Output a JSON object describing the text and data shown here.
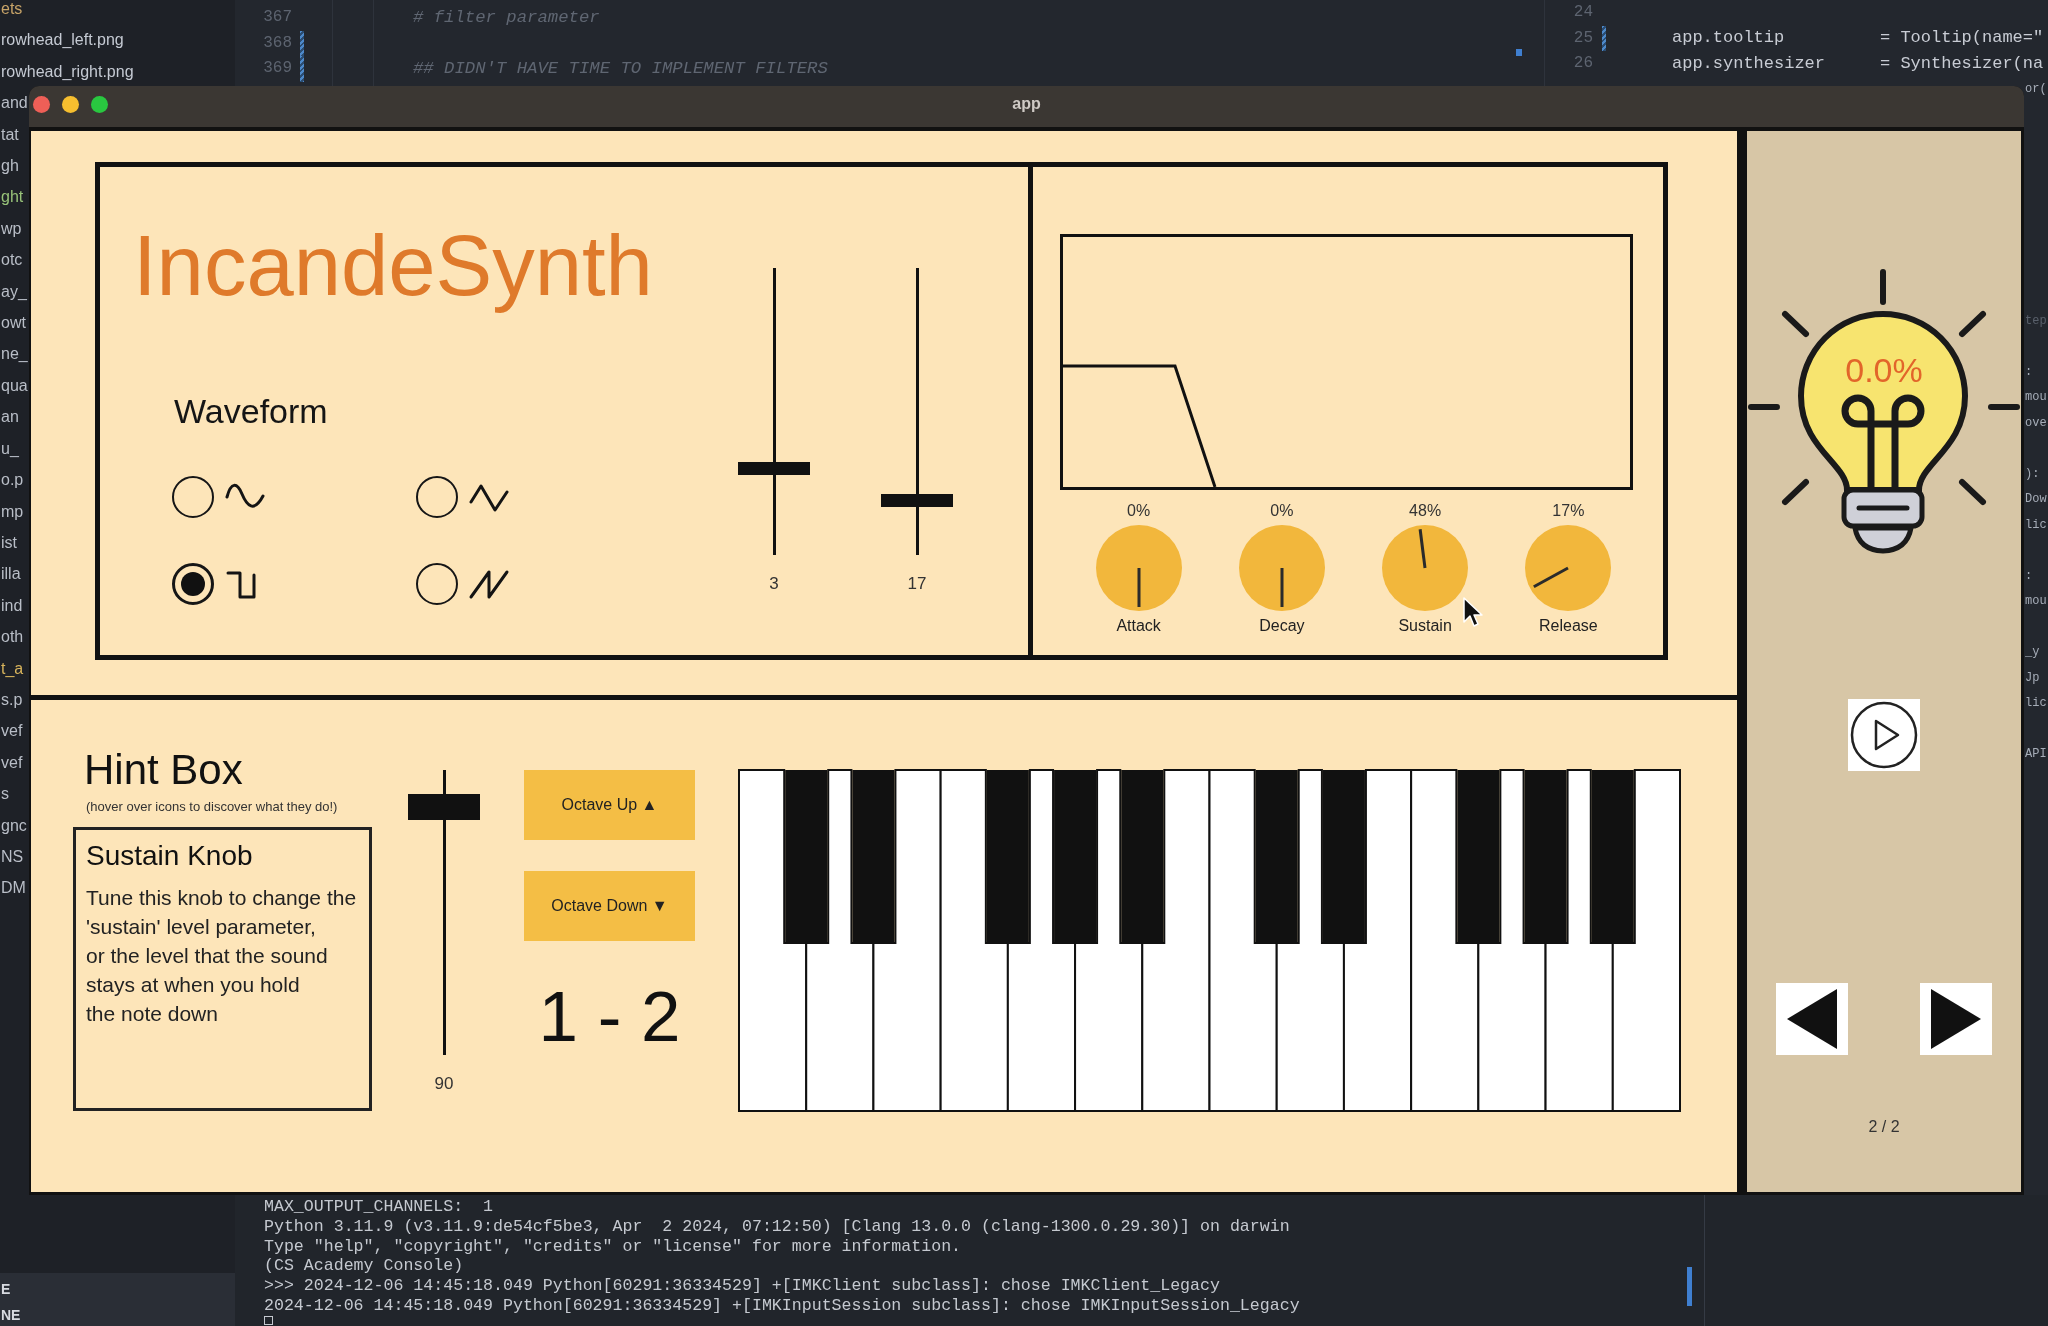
{
  "file_explorer": {
    "items": [
      {
        "label": "ets",
        "color": "#c8a468"
      },
      {
        "label": "rowhead_left.png",
        "color": "#c5cad3"
      },
      {
        "label": "rowhead_right.png",
        "color": "#c5cad3"
      },
      {
        "label": "and",
        "color": "#b9bec7"
      },
      {
        "label": "tat",
        "color": "#b9bec7"
      },
      {
        "label": "gh",
        "color": "#b9bec7"
      },
      {
        "label": "ght",
        "color": "#98c379"
      },
      {
        "label": "wp",
        "color": "#b9bec7"
      },
      {
        "label": "otc",
        "color": "#b9bec7"
      },
      {
        "label": "ay_",
        "color": "#b9bec7"
      },
      {
        "label": "owt",
        "color": "#b9bec7"
      },
      {
        "label": "ne_",
        "color": "#b9bec7"
      },
      {
        "label": "qua",
        "color": "#b9bec7"
      },
      {
        "label": "an",
        "color": "#b9bec7"
      },
      {
        "label": "u_",
        "color": "#b9bec7"
      },
      {
        "label": "o.p",
        "color": "#b9bec7"
      },
      {
        "label": "mp",
        "color": "#b9bec7"
      },
      {
        "label": "ist",
        "color": "#b9bec7"
      },
      {
        "label": "illa",
        "color": "#b9bec7"
      },
      {
        "label": "ind",
        "color": "#b9bec7"
      },
      {
        "label": "oth",
        "color": "#b9bec7"
      },
      {
        "label": "t_a",
        "color": "#d8b45c"
      },
      {
        "label": "s.p",
        "color": "#b9bec7"
      },
      {
        "label": "vef",
        "color": "#b9bec7"
      },
      {
        "label": "vef",
        "color": "#b9bec7"
      },
      {
        "label": "s",
        "color": "#b9bec7"
      },
      {
        "label": "gnc",
        "color": "#b9bec7"
      },
      {
        "label": "NS",
        "color": "#b9bec7"
      },
      {
        "label": "DM",
        "color": "#b9bec7"
      }
    ],
    "sections": [
      "E",
      "NE"
    ]
  },
  "editor": {
    "lines": [
      {
        "number": "367",
        "code": "# filter parameter",
        "changed": false
      },
      {
        "number": "368",
        "changed": true
      },
      {
        "number": "369",
        "code": "## DIDN'T HAVE TIME TO IMPLEMENT FILTERS",
        "changed": true
      }
    ]
  },
  "side_editor": {
    "lines": [
      {
        "kind": "numbered",
        "number": "24",
        "changed": false
      },
      {
        "kind": "numbered",
        "number": "25",
        "target": "app.tooltip",
        "value": "= Tooltip(name=\"",
        "changed": true
      },
      {
        "kind": "numbered",
        "number": "26",
        "target": "app.synthesizer",
        "value": "= Synthesizer(na",
        "changed": false
      },
      {
        "kind": "edge",
        "code": "or("
      }
    ],
    "edge_groups": [
      {
        "kind": "comment",
        "lines": [
          "tep"
        ]
      },
      {
        "kind": "code",
        "lines": [
          ":",
          "mou",
          "ove"
        ]
      },
      {
        "kind": "code",
        "lines": [
          "):",
          "Dow",
          "lic"
        ]
      },
      {
        "kind": "code",
        "lines": [
          ":",
          "mou"
        ]
      },
      {
        "kind": "code",
        "lines": [
          "_y",
          "Jp",
          "lic"
        ]
      },
      {
        "kind": "code",
        "lines": [
          "API"
        ]
      }
    ]
  },
  "console": {
    "lines": [
      "MAX_OUTPUT_CHANNELS:  1",
      "Python 3.11.9 (v3.11.9:de54cf5be3, Apr  2 2024, 07:12:50) [Clang 13.0.0 (clang-1300.0.29.30)] on darwin",
      "Type \"help\", \"copyright\", \"credits\" or \"license\" for more information.",
      "(CS Academy Console)",
      ">>> 2024-12-06 14:45:18.049 Python[60291:36334529] +[IMKClient subclass]: chose IMKClient_Legacy",
      "2024-12-06 14:45:18.049 Python[60291:36334529] +[IMKInputSession subclass]: chose IMKInputSession_Legacy"
    ]
  },
  "window": {
    "title": "app"
  },
  "synth": {
    "title": "IncandeSynth",
    "waveform": {
      "label": "Waveform",
      "options": [
        {
          "kind": "sine",
          "selected": false
        },
        {
          "kind": "triangle",
          "selected": false
        },
        {
          "kind": "square",
          "selected": true
        },
        {
          "kind": "sawtooth",
          "selected": false
        }
      ]
    },
    "sliders": [
      {
        "reading": "3",
        "level": 0.3
      },
      {
        "reading": "17",
        "level": 0.19
      }
    ],
    "knobs": [
      {
        "label": "Attack",
        "reading": "0%"
      },
      {
        "label": "Decay",
        "reading": "0%"
      },
      {
        "label": "Sustain",
        "reading": "48%"
      },
      {
        "label": "Release",
        "reading": "17%"
      }
    ]
  },
  "hint_box": {
    "title": "Hint Box",
    "subtitle": "(hover over icons to discover what they do!)",
    "card_title": "Sustain Knob",
    "card_text": "Tune this knob to change the\n'sustain' level parameter,\nor the level that the sound\nstays at when you hold\nthe note down"
  },
  "volume": {
    "reading": "90",
    "level": 0.87
  },
  "octave": {
    "buttons": [
      "Octave Up ▲",
      "Octave Down ▼"
    ],
    "range": "1 - 2"
  },
  "sidebar": {
    "bulb_reading": "0.0%",
    "page": "2 / 2"
  }
}
